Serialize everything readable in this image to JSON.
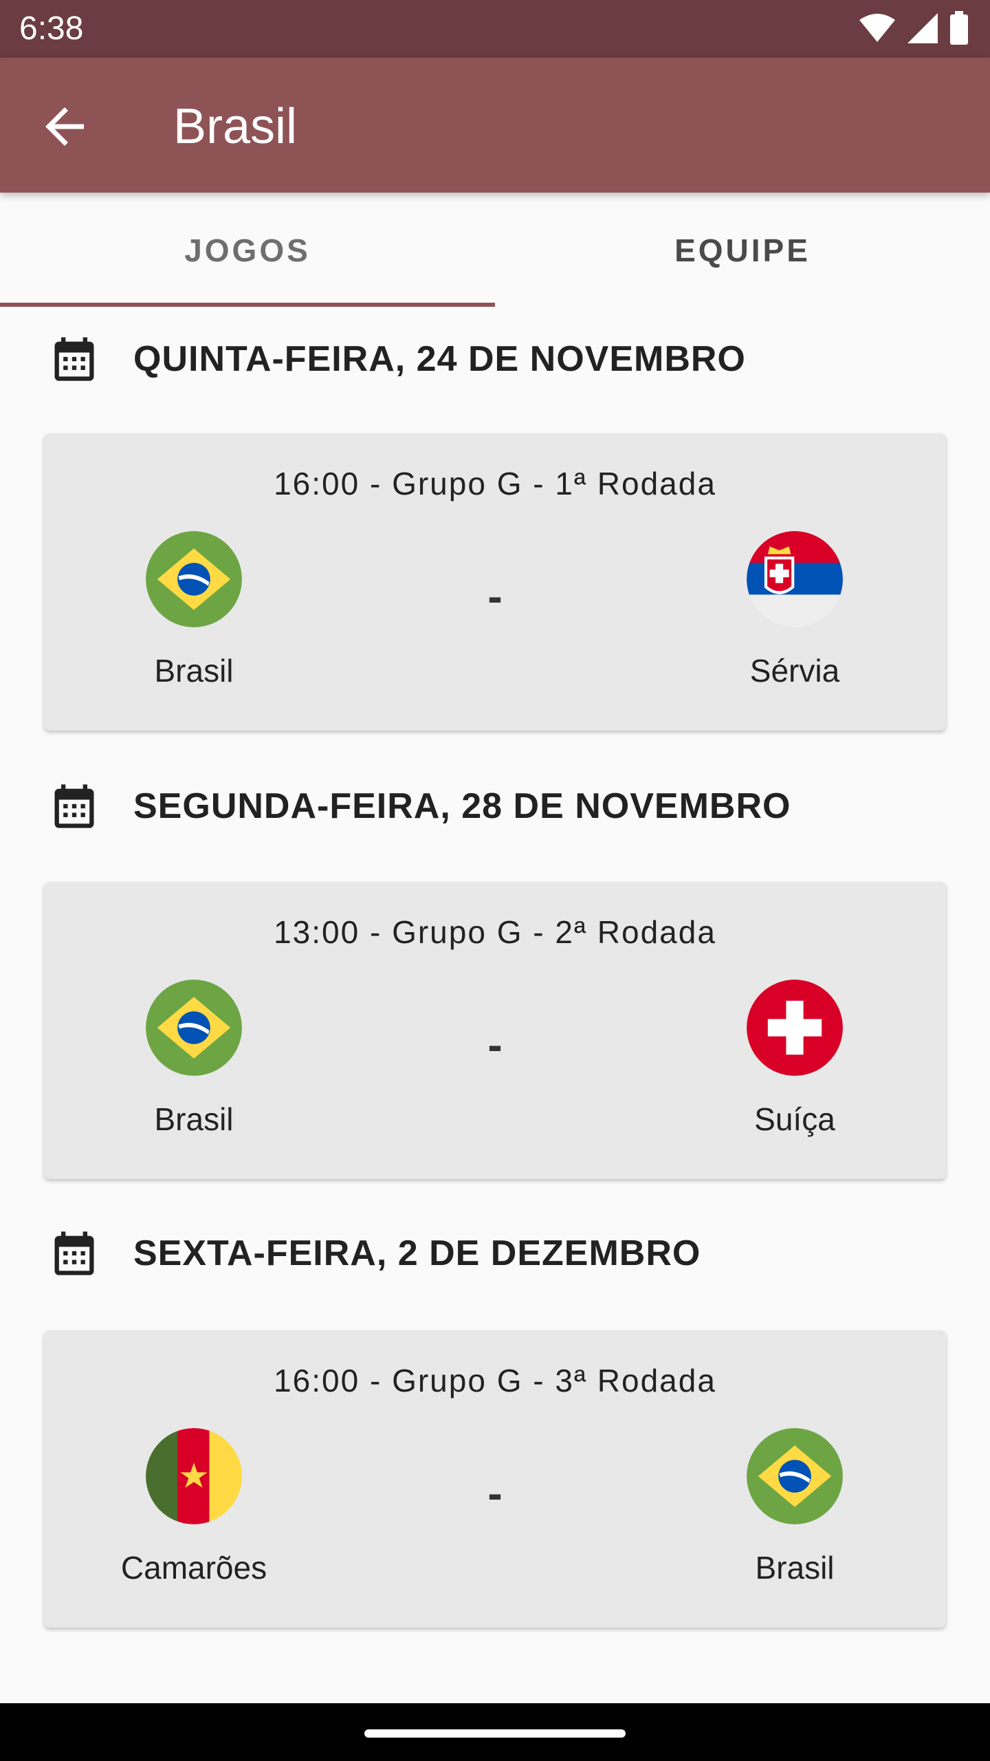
{
  "status_bar": {
    "time": "6:38",
    "icons": [
      "wifi-icon",
      "signal-icon",
      "battery-icon"
    ]
  },
  "app_bar": {
    "title": "Brasil",
    "back_icon": "arrow-back-icon"
  },
  "tabs": [
    {
      "label": "JOGOS",
      "selected": true
    },
    {
      "label": "EQUIPE",
      "selected": false
    }
  ],
  "matches": [
    {
      "date": "QUINTA-FEIRA, 24 DE NOVEMBRO",
      "info": "16:00 - Grupo G - 1ª Rodada",
      "home": {
        "name": "Brasil",
        "flag": "brazil-flag-icon"
      },
      "away": {
        "name": "Sérvia",
        "flag": "serbia-flag-icon"
      },
      "score": "-"
    },
    {
      "date": "SEGUNDA-FEIRA, 28 DE NOVEMBRO",
      "info": "13:00 - Grupo G - 2ª Rodada",
      "home": {
        "name": "Brasil",
        "flag": "brazil-flag-icon"
      },
      "away": {
        "name": "Suíça",
        "flag": "switzerland-flag-icon"
      },
      "score": "-"
    },
    {
      "date": "SEXTA-FEIRA, 2 DE DEZEMBRO",
      "info": "16:00 - Grupo G - 3ª Rodada",
      "home": {
        "name": "Camarões",
        "flag": "cameroon-flag-icon"
      },
      "away": {
        "name": "Brasil",
        "flag": "brazil-flag-icon"
      },
      "score": "-"
    }
  ],
  "colors": {
    "status_bar": "#6b3c41",
    "app_bar": "#8e5455",
    "tab_indicator": "#8e5455",
    "card": "#e8e8e8"
  }
}
